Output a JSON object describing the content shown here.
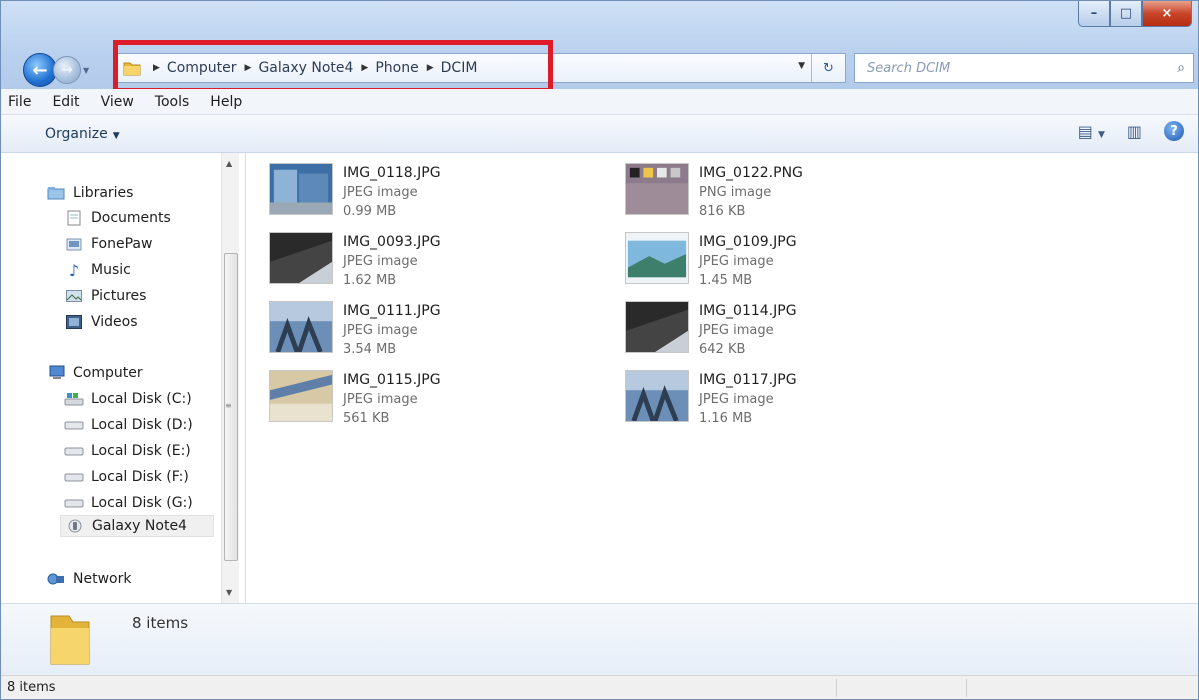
{
  "window": {
    "buttons": {
      "minimize": "–",
      "maximize": "□",
      "close": "×"
    }
  },
  "address": {
    "crumbs": [
      "Computer",
      "Galaxy Note4",
      "Phone",
      "DCIM"
    ],
    "search_placeholder": "Search DCIM"
  },
  "menu": [
    "File",
    "Edit",
    "View",
    "Tools",
    "Help"
  ],
  "toolbar": {
    "organize": "Organize"
  },
  "nav": {
    "libraries": "Libraries",
    "library_items": [
      "Documents",
      "FonePaw",
      "Music",
      "Pictures",
      "Videos"
    ],
    "computer": "Computer",
    "drives": [
      "Local Disk (C:)",
      "Local Disk (D:)",
      "Local Disk (E:)",
      "Local Disk (F:)",
      "Local Disk (G:)",
      "Galaxy Note4"
    ],
    "network": "Network"
  },
  "files": [
    {
      "name": "IMG_0118.JPG",
      "type": "JPEG image",
      "size": "0.99 MB"
    },
    {
      "name": "IMG_0122.PNG",
      "type": "PNG image",
      "size": "816 KB"
    },
    {
      "name": "IMG_0093.JPG",
      "type": "JPEG image",
      "size": "1.62 MB"
    },
    {
      "name": "IMG_0109.JPG",
      "type": "JPEG image",
      "size": "1.45 MB"
    },
    {
      "name": "IMG_0111.JPG",
      "type": "JPEG image",
      "size": "3.54 MB"
    },
    {
      "name": "IMG_0114.JPG",
      "type": "JPEG image",
      "size": "642 KB"
    },
    {
      "name": "IMG_0115.JPG",
      "type": "JPEG image",
      "size": "561 KB"
    },
    {
      "name": "IMG_0117.JPG",
      "type": "JPEG image",
      "size": "1.16 MB"
    }
  ],
  "details": {
    "count": "8 items"
  },
  "status": {
    "text": "8 items"
  },
  "colors": {
    "highlight": "#de1b29",
    "accent": "#1f6fd0"
  }
}
